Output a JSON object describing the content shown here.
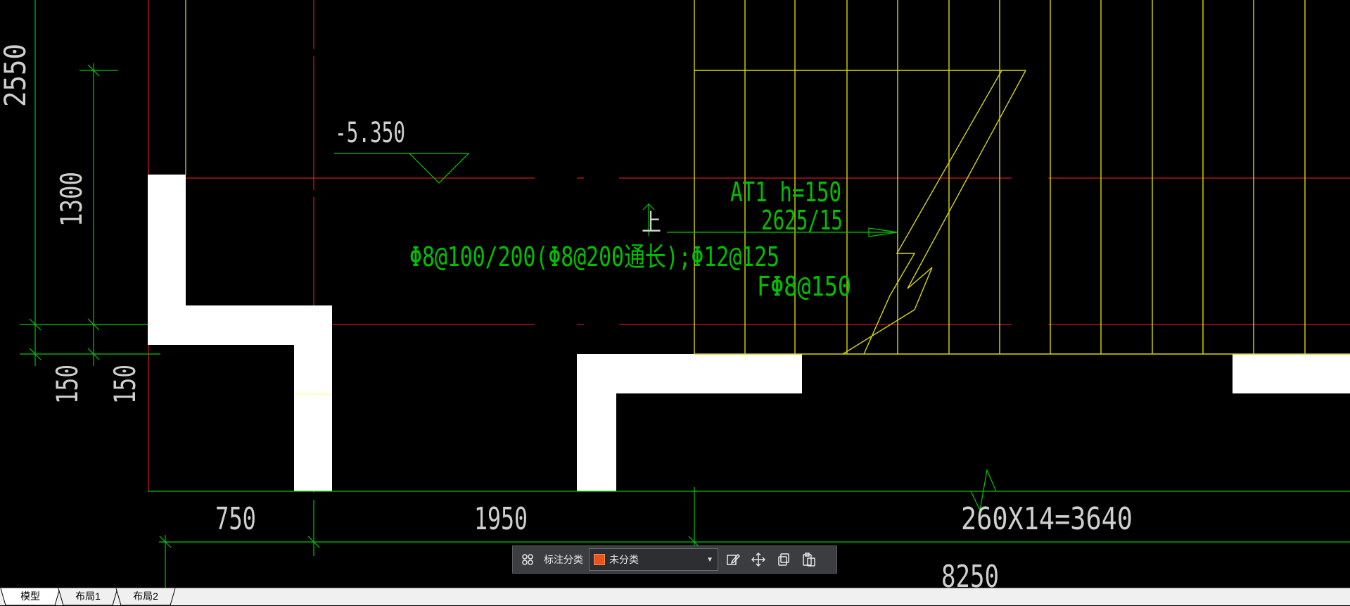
{
  "drawing": {
    "dimensions": {
      "top_left_vertical": "2550",
      "left_vertical_1300": "1300",
      "left_vertical_150_a": "150",
      "left_vertical_150_b": "150",
      "bottom_750": "750",
      "bottom_1950": "1950",
      "bottom_steps": "260X14=3640",
      "bottom_total": "8250"
    },
    "elevation_mark": "-5.350",
    "stair_annotation": {
      "name_height": "AT1  h=150",
      "steps": "2625/15",
      "reinforcement": "Φ8@100/200(Φ8@200通长);Φ12@125",
      "distribution": "FΦ8@150",
      "arrow_label": "上"
    },
    "colors": {
      "background": "#000000",
      "axis_red": "#ff2020",
      "dimension_green": "#00c800",
      "stair_yellow": "#d8d800",
      "slab_white": "#ffffff"
    }
  },
  "toolbar": {
    "label": "标注分类",
    "category_value": "未分类",
    "icons": [
      "grid-icon",
      "edit-icon",
      "move-icon",
      "copy-icon",
      "paste-icon"
    ]
  },
  "tabs": [
    {
      "label": "模型",
      "active": true
    },
    {
      "label": "布局1",
      "active": false
    },
    {
      "label": "布局2",
      "active": false
    }
  ]
}
